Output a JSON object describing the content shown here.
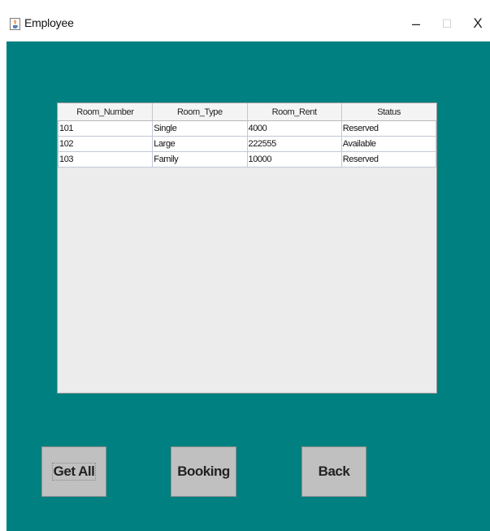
{
  "window": {
    "title": "Employee",
    "minimize_glyph": "–",
    "maximize_glyph": "☐",
    "close_glyph": "X",
    "icon": "java-cup-icon"
  },
  "colors": {
    "background": "#008080",
    "button": "#c0c0c0"
  },
  "table": {
    "headers": [
      "Room_Number",
      "Room_Type",
      "Room_Rent",
      "Status"
    ],
    "rows": [
      [
        "101",
        "Single",
        "4000",
        "Reserved"
      ],
      [
        "102",
        "Large",
        "222555",
        "Available"
      ],
      [
        "103",
        "Family",
        "10000",
        "Reserved"
      ]
    ]
  },
  "buttons": {
    "get_all": "Get All",
    "booking": "Booking",
    "back": "Back"
  }
}
